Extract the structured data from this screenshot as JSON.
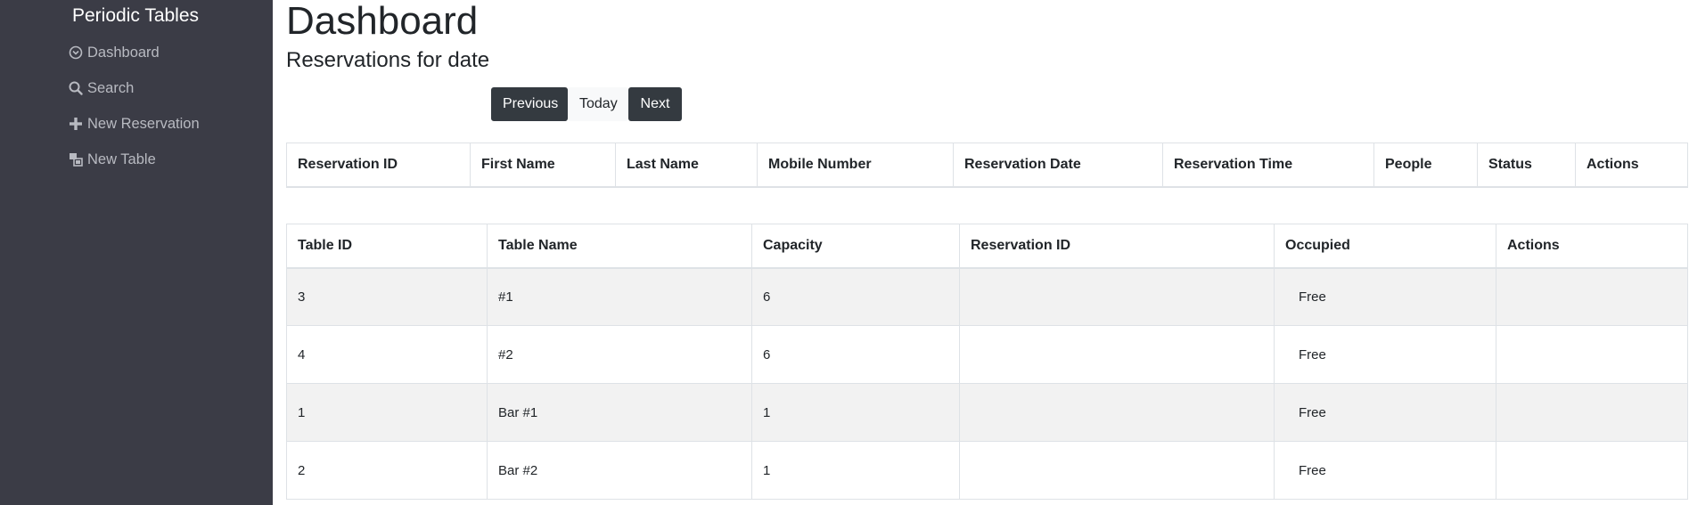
{
  "sidebar": {
    "brand": "Periodic Tables",
    "items": [
      {
        "label": "Dashboard",
        "icon": "dashboard-icon"
      },
      {
        "label": "Search",
        "icon": "search-icon"
      },
      {
        "label": "New Reservation",
        "icon": "plus-icon"
      },
      {
        "label": "New Table",
        "icon": "table-icon"
      }
    ]
  },
  "main": {
    "title": "Dashboard",
    "subtitle": "Reservations for date",
    "buttons": {
      "previous": "Previous",
      "today": "Today",
      "next": "Next"
    },
    "reservations_table": {
      "headers": [
        "Reservation ID",
        "First Name",
        "Last Name",
        "Mobile Number",
        "Reservation Date",
        "Reservation Time",
        "People",
        "Status",
        "Actions"
      ],
      "rows": []
    },
    "tables_table": {
      "headers": [
        "Table ID",
        "Table Name",
        "Capacity",
        "Reservation ID",
        "Occupied",
        "Actions"
      ],
      "rows": [
        [
          "3",
          "#1",
          "6",
          "",
          "Free",
          ""
        ],
        [
          "4",
          "#2",
          "6",
          "",
          "Free",
          ""
        ],
        [
          "1",
          "Bar #1",
          "1",
          "",
          "Free",
          ""
        ],
        [
          "2",
          "Bar #2",
          "1",
          "",
          "Free",
          ""
        ]
      ]
    }
  },
  "colors": {
    "sidebar_bg": "#3b3c46",
    "sidebar_text": "#b8bac1",
    "button_dark": "#343a40",
    "stripe": "#f2f2f2"
  }
}
